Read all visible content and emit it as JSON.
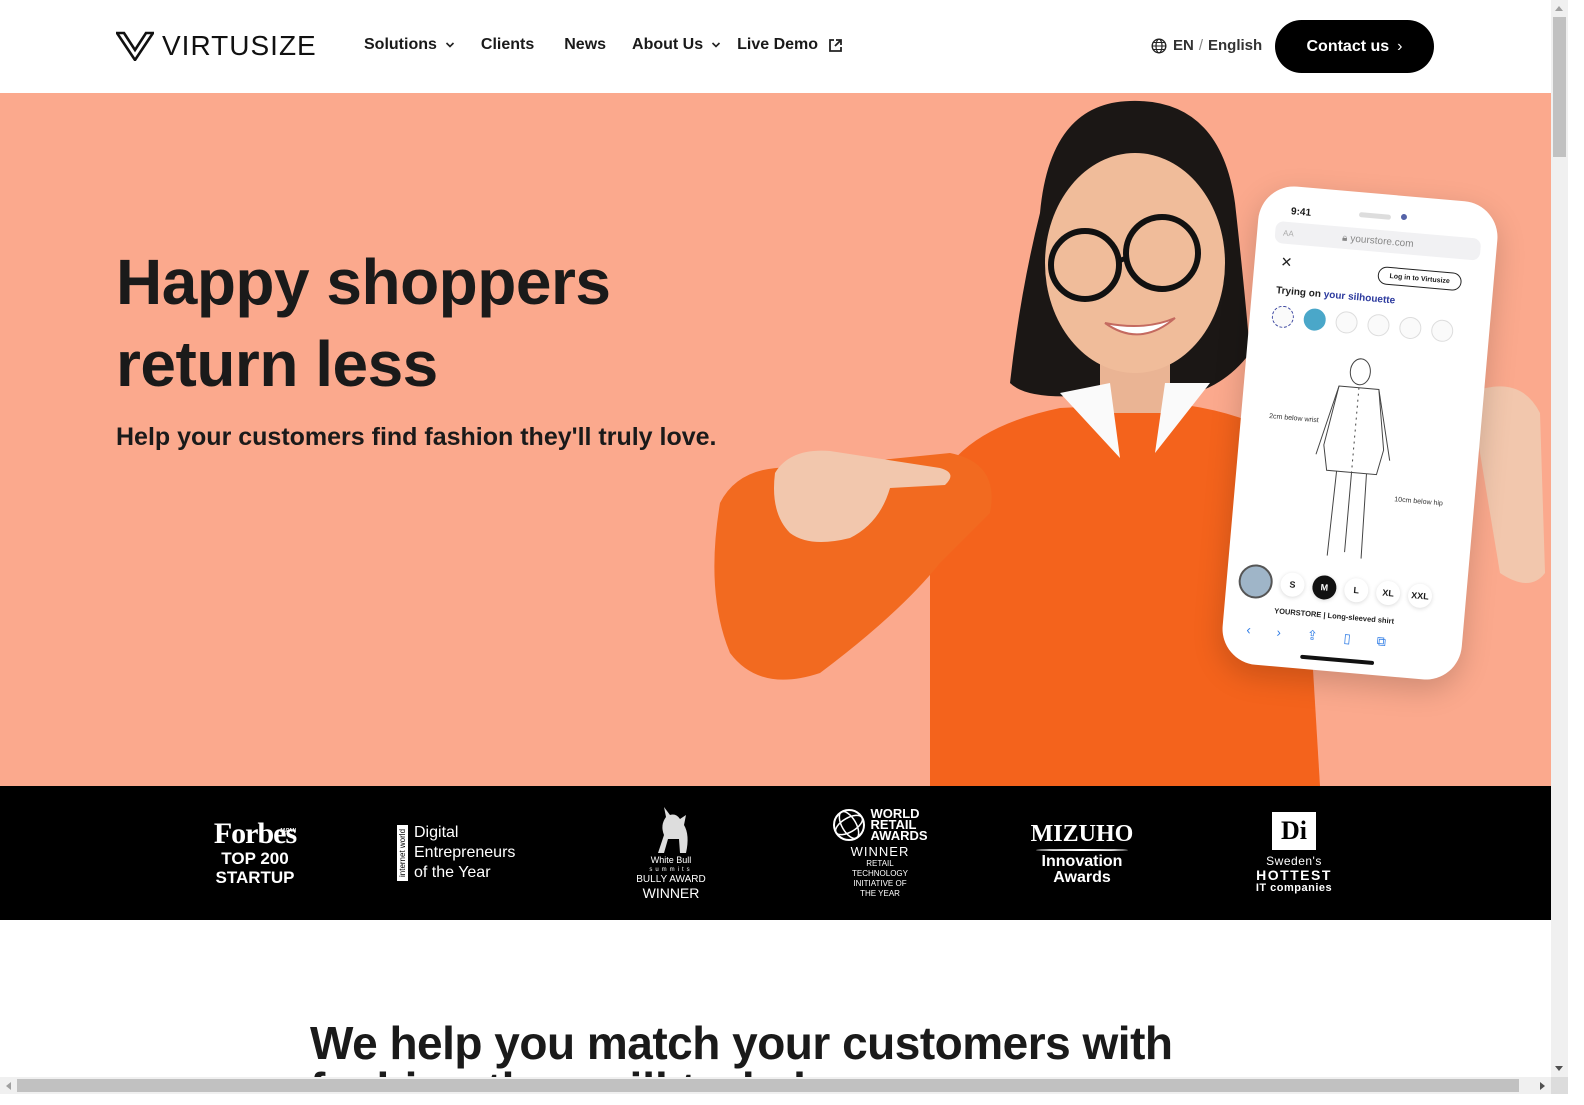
{
  "header": {
    "logo_text": "VIRTUSIZE",
    "nav": [
      {
        "label": "Solutions",
        "has_dropdown": true
      },
      {
        "label": "Clients",
        "has_dropdown": false
      },
      {
        "label": "News",
        "has_dropdown": false
      },
      {
        "label": "About Us",
        "has_dropdown": true
      },
      {
        "label": "Live Demo",
        "external": true
      }
    ],
    "language": {
      "code": "EN",
      "separator": "/",
      "name": "English",
      "icon": "globe-icon"
    },
    "contact_label": "Contact us",
    "contact_arrow": "›"
  },
  "hero": {
    "title_line1": "Happy shoppers",
    "title_line2": "return less",
    "subtitle": "Help your customers find fashion they'll truly love.",
    "background_color": "#fba98d",
    "phone": {
      "time": "9:41",
      "url": "yourstore.com",
      "text_size_label": "AA",
      "login_label": "Log in to Virtusize",
      "trying_prefix": "Trying on",
      "trying_highlight": "your silhouette",
      "label_wrist": "2cm below wrist",
      "label_hip": "10cm below hip",
      "sizes": [
        "S",
        "M",
        "L",
        "XL",
        "XXL"
      ],
      "selected_size": "M",
      "product": "YOURSTORE | Long-sleeved shirt"
    }
  },
  "awards": [
    {
      "name": "forbes",
      "logo": "Forbes",
      "logo_sub": "JAPAN",
      "line1": "TOP 200",
      "line2": "STARTUP"
    },
    {
      "name": "internet-world",
      "tag": "internet world",
      "line1": "Digital",
      "line2": "Entrepreneurs",
      "line3": "of the Year"
    },
    {
      "name": "white-bull",
      "brand": "White Bull",
      "brand_sub": "summits",
      "line1": "BULLY AWARD",
      "line2": "WINNER"
    },
    {
      "name": "world-retail-awards",
      "title1": "WORLD",
      "title2": "RETAIL",
      "title3": "AWARDS",
      "line1": "WINNER",
      "line2": "RETAIL",
      "line3": "TECHNOLOGY",
      "line4": "INITIATIVE OF",
      "line5": "THE YEAR"
    },
    {
      "name": "mizuho",
      "logo": "MIZUHO",
      "line1": "Innovation",
      "line2": "Awards"
    },
    {
      "name": "di",
      "logo": "Di",
      "line1": "Sweden's",
      "line2": "HOTTEST",
      "line3": "IT companies"
    }
  ],
  "section": {
    "heading_line1": "We help you match your customers with",
    "heading_line2": "fashion they will truly love"
  }
}
